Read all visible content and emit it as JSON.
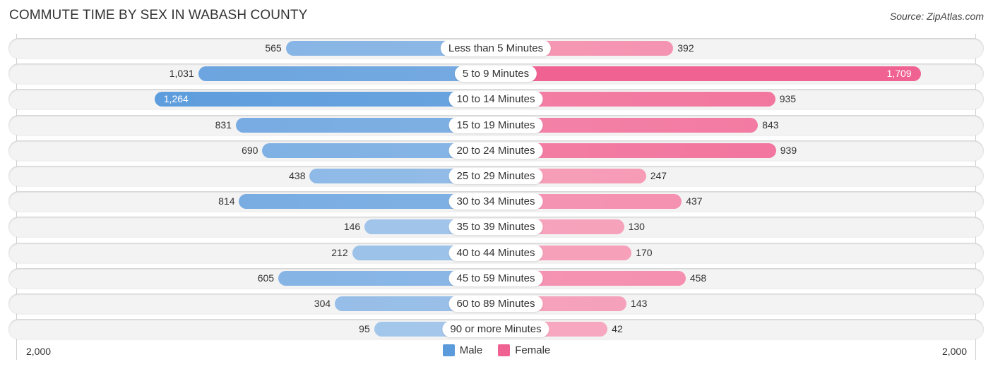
{
  "header": {
    "title": "COMMUTE TIME BY SEX IN WABASH COUNTY",
    "source": "Source: ZipAtlas.com"
  },
  "colors": {
    "male_strong": "#5b9bdc",
    "male_light": "#a9c9ec",
    "female_strong": "#f06292",
    "female_light": "#f7a9c0"
  },
  "chart_data": {
    "type": "bar",
    "orientation": "horizontal-diverging",
    "title": "COMMUTE TIME BY SEX IN WABASH COUNTY",
    "categories": [
      "Less than 5 Minutes",
      "5 to 9 Minutes",
      "10 to 14 Minutes",
      "15 to 19 Minutes",
      "20 to 24 Minutes",
      "25 to 29 Minutes",
      "30 to 34 Minutes",
      "35 to 39 Minutes",
      "40 to 44 Minutes",
      "45 to 59 Minutes",
      "60 to 89 Minutes",
      "90 or more Minutes"
    ],
    "series": [
      {
        "name": "Male",
        "side": "left",
        "values": [
          565,
          1031,
          1264,
          831,
          690,
          438,
          814,
          146,
          212,
          605,
          304,
          95
        ],
        "labels": [
          "565",
          "1,031",
          "1,264",
          "831",
          "690",
          "438",
          "814",
          "146",
          "212",
          "605",
          "304",
          "95"
        ]
      },
      {
        "name": "Female",
        "side": "right",
        "values": [
          392,
          1709,
          935,
          843,
          939,
          247,
          437,
          130,
          170,
          458,
          143,
          42
        ],
        "labels": [
          "392",
          "1,709",
          "935",
          "843",
          "939",
          "247",
          "437",
          "130",
          "170",
          "458",
          "143",
          "42"
        ]
      }
    ],
    "xlim": [
      0,
      2000
    ],
    "tick_labels": {
      "left": "2,000",
      "right": "2,000"
    },
    "legend": {
      "position": "bottom-center",
      "entries": [
        "Male",
        "Female"
      ]
    },
    "grid": false
  }
}
